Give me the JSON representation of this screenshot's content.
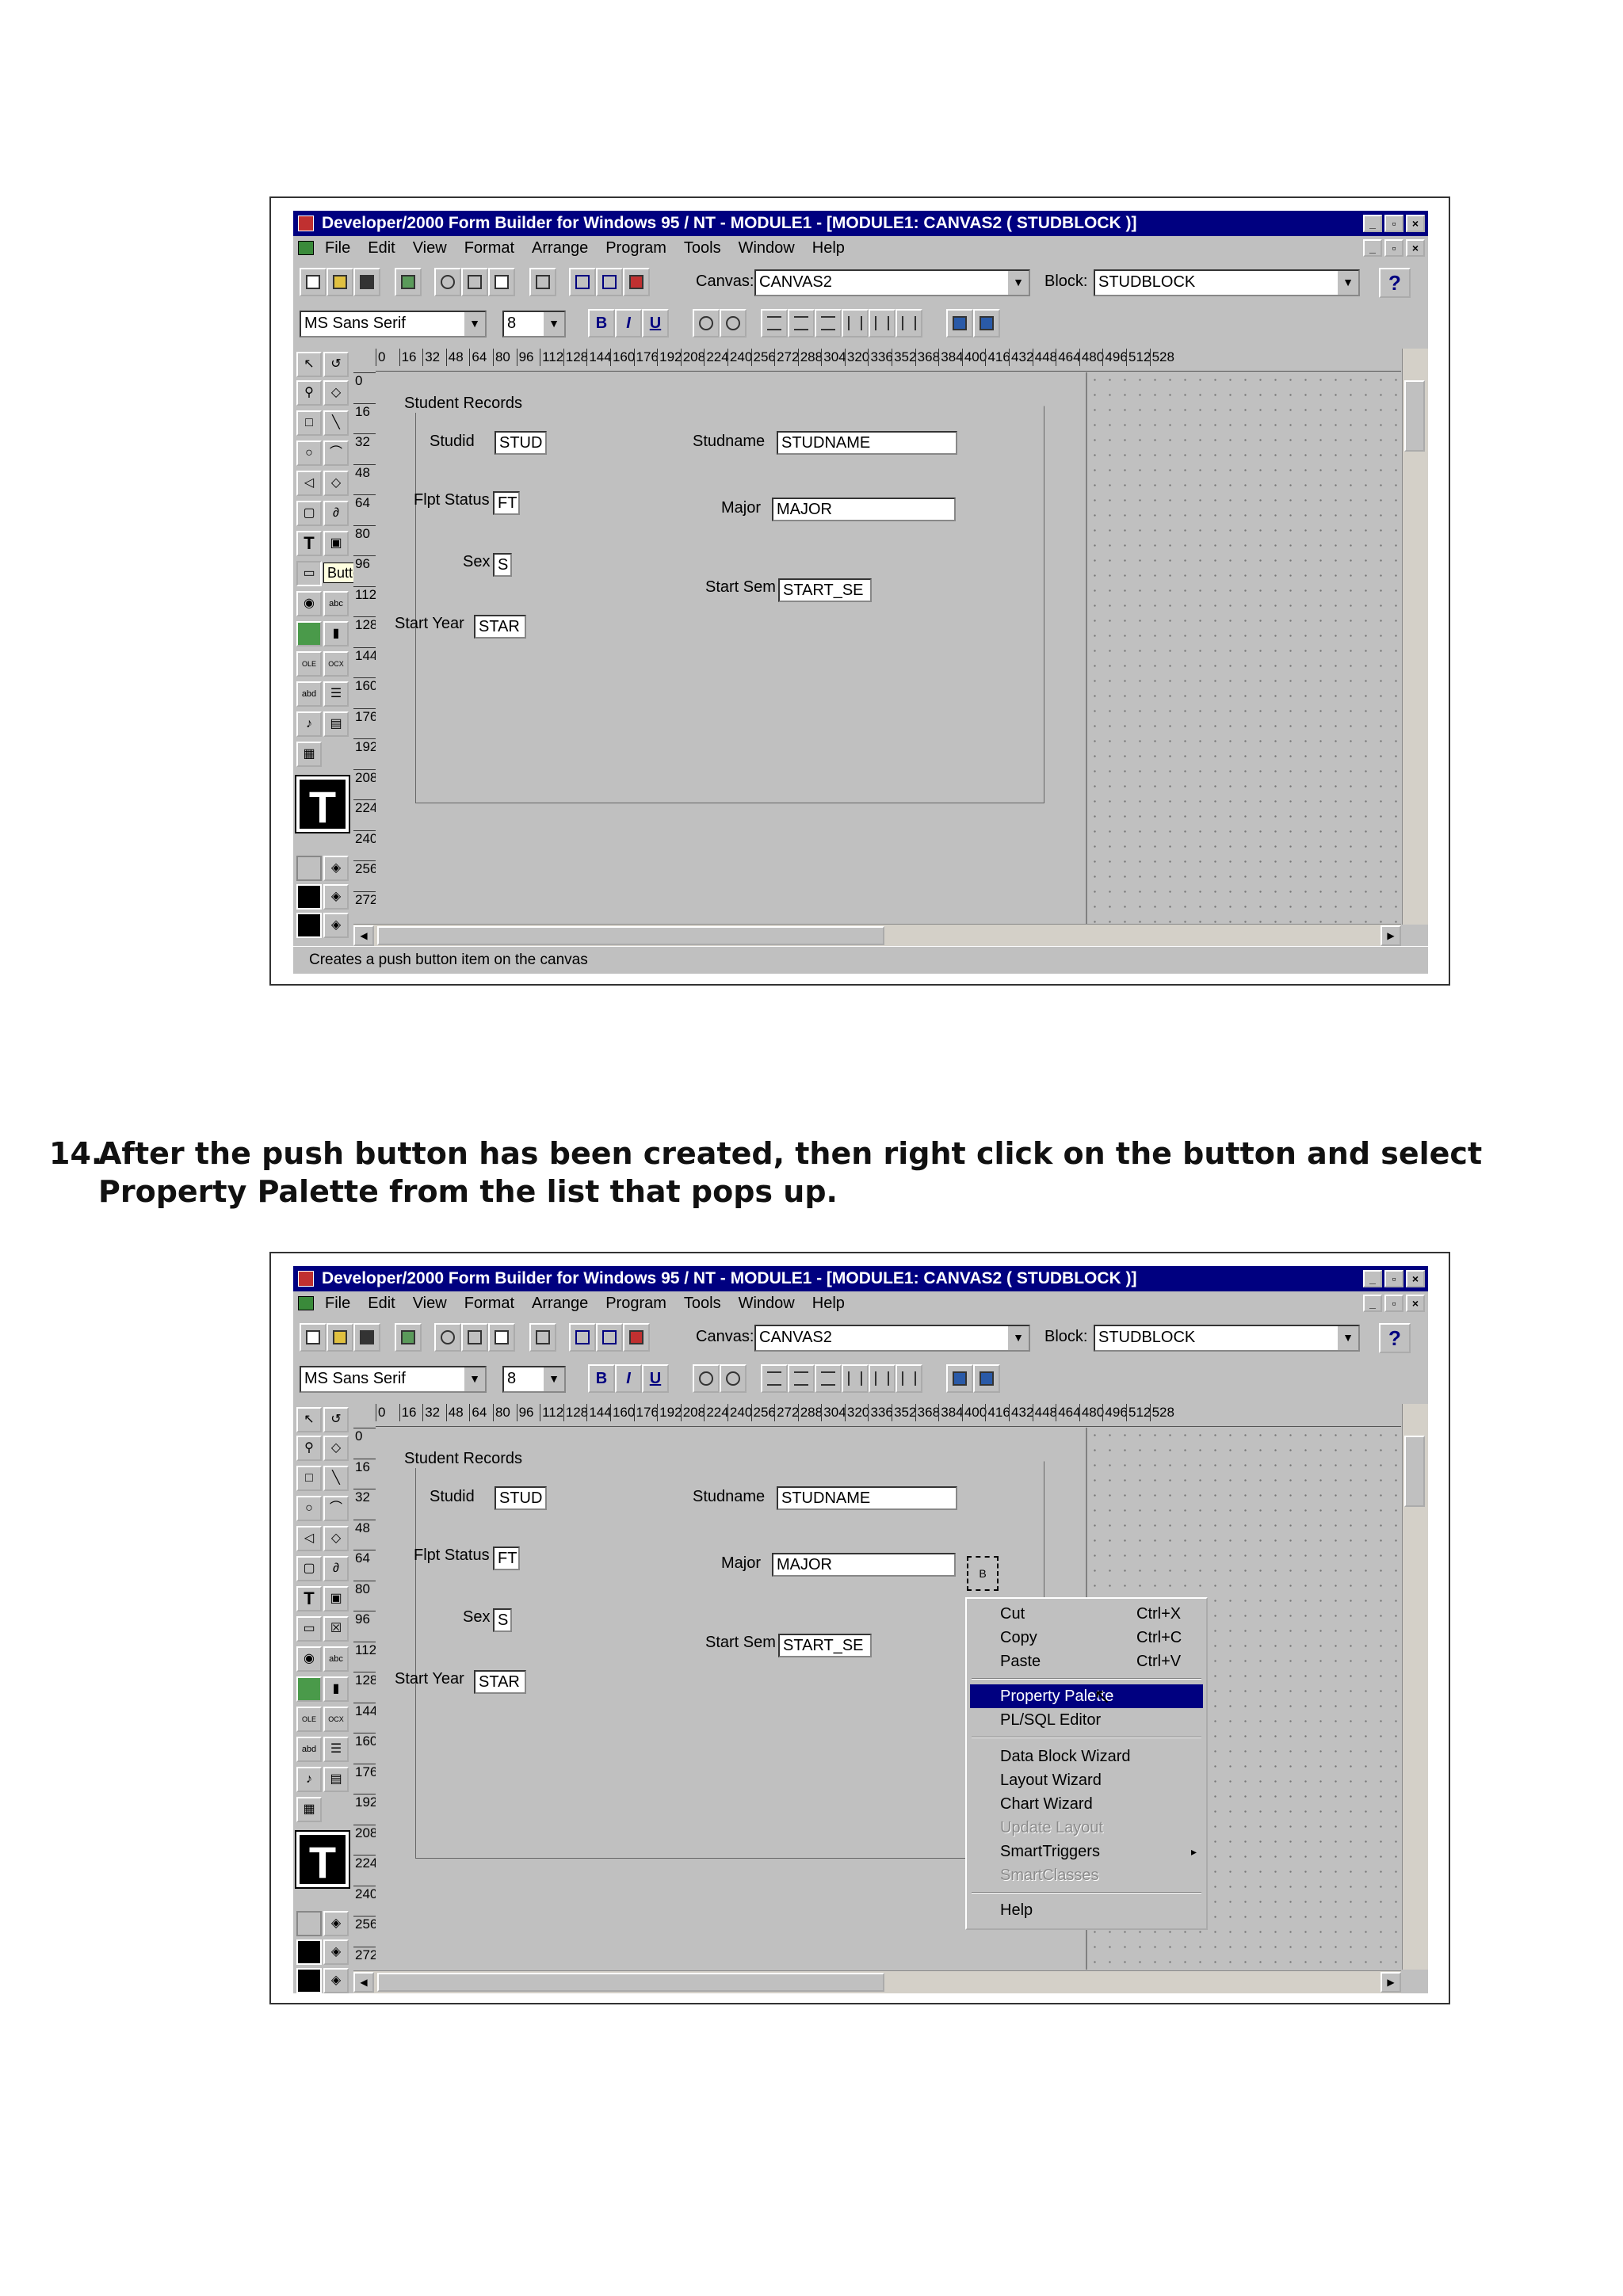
{
  "window": {
    "title": "Developer/2000 Form Builder for Windows 95 / NT - MODULE1 - [MODULE1: CANVAS2 ( STUDBLOCK )]",
    "menus": [
      "File",
      "Edit",
      "View",
      "Format",
      "Arrange",
      "Program",
      "Tools",
      "Window",
      "Help"
    ],
    "canvas_label": "Canvas:",
    "canvas_value": "CANVAS2",
    "block_label": "Block:",
    "block_value": "STUDBLOCK",
    "help_glyph": "?",
    "font_name": "MS Sans Serif",
    "font_size": "8",
    "format_buttons": [
      "B",
      "I",
      "U"
    ],
    "hruler": [
      "0",
      "16",
      "32",
      "48",
      "64",
      "80",
      "96",
      "112",
      "128",
      "144",
      "160",
      "176",
      "192",
      "208",
      "224",
      "240",
      "256",
      "272",
      "288",
      "304",
      "320",
      "336",
      "352",
      "368",
      "384",
      "400",
      "416",
      "432",
      "448",
      "464",
      "480",
      "496",
      "512",
      "528"
    ],
    "vruler": [
      "0",
      "16",
      "32",
      "48",
      "64",
      "80",
      "96",
      "112",
      "128",
      "144",
      "160",
      "176",
      "192",
      "208",
      "224",
      "240",
      "256",
      "272"
    ]
  },
  "form": {
    "frame_title": "Student Records",
    "studid_label": "Studid",
    "studid_value": "STUD",
    "studname_label": "Studname",
    "studname_value": "STUDNAME",
    "fpst_label": "Flpt Status",
    "fpst_value": "FT",
    "major_label": "Major",
    "major_value": "MAJOR",
    "sex_label": "Sex",
    "sex_value": "S",
    "startsem_label": "Start Sem",
    "startsem_value": "START_SE",
    "startyear_label": "Start Year",
    "startyear_value": "STAR"
  },
  "screenshot1": {
    "tooltip": "Button",
    "status": "Creates a push button item on the canvas"
  },
  "instruction": {
    "number": "14.",
    "text": "After the push button has been created, then right click on the button and select Property Palette from the list that pops up."
  },
  "context_menu": {
    "items": [
      {
        "label": "Cut",
        "shortcut": "Ctrl+X"
      },
      {
        "label": "Copy",
        "shortcut": "Ctrl+C"
      },
      {
        "label": "Paste",
        "shortcut": "Ctrl+V"
      },
      {
        "label": "Property Palette",
        "shortcut": ""
      },
      {
        "label": "PL/SQL Editor",
        "shortcut": ""
      },
      {
        "label": "Data Block Wizard",
        "shortcut": ""
      },
      {
        "label": "Layout Wizard",
        "shortcut": ""
      },
      {
        "label": "Chart Wizard",
        "shortcut": ""
      },
      {
        "label": "Update Layout",
        "shortcut": ""
      },
      {
        "label": "SmartTriggers",
        "shortcut": ""
      },
      {
        "label": "SmartClasses",
        "shortcut": ""
      },
      {
        "label": "Help",
        "shortcut": ""
      }
    ],
    "selected": "Property Palette",
    "disabled": [
      "Update Layout",
      "SmartClasses"
    ],
    "submenu_indicator": "▸",
    "button_glyph": "B"
  },
  "icons": [
    "app-icon",
    "new-icon",
    "open-icon",
    "save-icon",
    "run-icon",
    "cut-icon",
    "copy-icon",
    "paste-icon",
    "select-icon",
    "magnify-icon",
    "text-tool-icon",
    "button-tool-icon",
    "pointer-cursor-icon"
  ],
  "colors": {
    "titlebar": "#000080",
    "face": "#c0c0c0",
    "selection": "#000080"
  }
}
